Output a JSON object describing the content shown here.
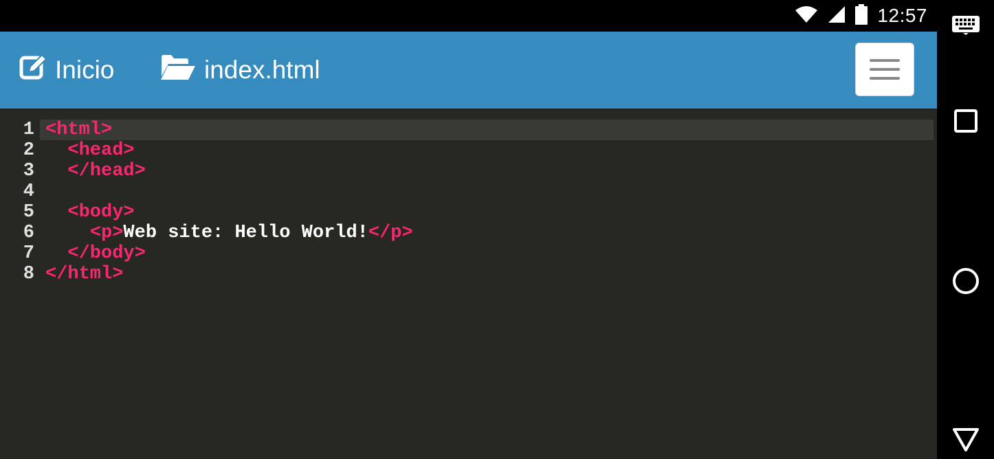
{
  "status": {
    "time": "12:57"
  },
  "header": {
    "home_label": "Inicio",
    "file_label": "index.html"
  },
  "editor": {
    "lines": [
      {
        "num": "1",
        "indent": "",
        "parts": [
          [
            "tag",
            "<html>"
          ]
        ]
      },
      {
        "num": "2",
        "indent": "  ",
        "parts": [
          [
            "tag",
            "<head>"
          ]
        ]
      },
      {
        "num": "3",
        "indent": "  ",
        "parts": [
          [
            "tag",
            "</head>"
          ]
        ]
      },
      {
        "num": "4",
        "indent": "",
        "parts": []
      },
      {
        "num": "5",
        "indent": "  ",
        "parts": [
          [
            "tag",
            "<body>"
          ]
        ]
      },
      {
        "num": "6",
        "indent": "    ",
        "parts": [
          [
            "tag",
            "<p>"
          ],
          [
            "txt",
            "Web site: Hello World!"
          ],
          [
            "tag",
            "</p>"
          ]
        ]
      },
      {
        "num": "7",
        "indent": "  ",
        "parts": [
          [
            "tag",
            "</body>"
          ]
        ]
      },
      {
        "num": "8",
        "indent": "",
        "parts": [
          [
            "tag",
            "</html>"
          ]
        ]
      }
    ]
  },
  "colors": {
    "appbar": "#378cbf",
    "editor_bg": "#272822",
    "tag": "#f92672",
    "text": "#ffffff"
  },
  "icons": [
    "wifi-icon",
    "signal-icon",
    "battery-icon",
    "edit-icon",
    "folder-open-icon",
    "hamburger-menu-icon",
    "keyboard-icon",
    "recents-icon",
    "home-icon",
    "back-icon"
  ]
}
